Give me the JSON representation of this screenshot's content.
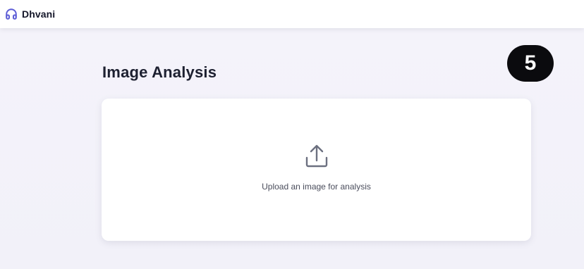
{
  "app": {
    "name": "Dhvani",
    "logo_icon": "headphones-icon",
    "accent_color": "#5b5bd6"
  },
  "page": {
    "title": "Image Analysis",
    "step_badge": "5"
  },
  "upload": {
    "icon": "upload-icon",
    "prompt": "Upload an image for analysis"
  }
}
